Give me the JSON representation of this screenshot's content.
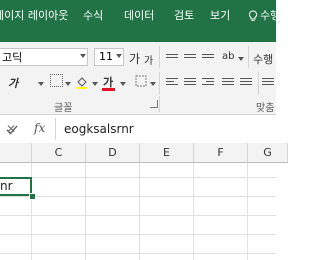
{
  "tabs": [
    {
      "label": "페이지 레이아웃"
    },
    {
      "label": "수식"
    },
    {
      "label": "데이터"
    },
    {
      "label": "검토"
    },
    {
      "label": "보기"
    },
    {
      "label": "수행"
    }
  ],
  "ribbon": {
    "font_name": "고딕",
    "font_size": "11",
    "increase_font": "가",
    "decrease_font": "가",
    "italic": "가",
    "underline": "가",
    "font_color_letter": "가",
    "group_font": "글꼴",
    "group_align": "맞춤"
  },
  "formula_bar": {
    "fx_label": "fx",
    "value": "eogksalsrnr"
  },
  "columns": [
    "C",
    "D",
    "E",
    "F",
    "G"
  ],
  "active_cell_text": "nr",
  "colors": {
    "accent": "#217346",
    "font_color": "#e81123"
  },
  "icons": [
    "lightbulb-icon",
    "cancel-icon",
    "enter-icon",
    "border-icon",
    "fill-color-icon",
    "align-icons",
    "dialog-launcher-icon"
  ]
}
